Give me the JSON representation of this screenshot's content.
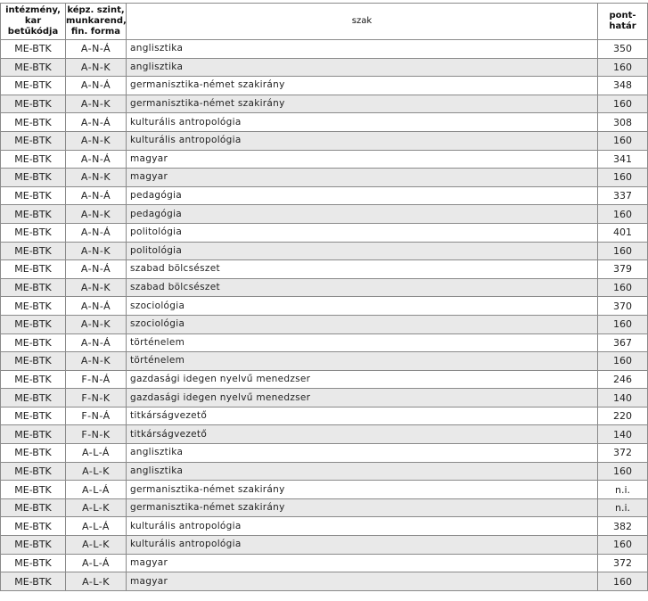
{
  "table": {
    "headers": {
      "institution": "intézmény, kar betűkódja",
      "form": "képz. szint, munkarend, fin. forma",
      "program": "szak",
      "points": "pont-határ"
    },
    "rows": [
      {
        "inst": "ME-BTK",
        "form": "A-N-Á",
        "szak": "anglisztika",
        "pont": "350"
      },
      {
        "inst": "ME-BTK",
        "form": "A-N-K",
        "szak": "anglisztika",
        "pont": "160"
      },
      {
        "inst": "ME-BTK",
        "form": "A-N-Á",
        "szak": "germanisztika-német szakirány",
        "pont": "348"
      },
      {
        "inst": "ME-BTK",
        "form": "A-N-K",
        "szak": "germanisztika-német szakirány",
        "pont": "160"
      },
      {
        "inst": "ME-BTK",
        "form": "A-N-Á",
        "szak": "kulturális antropológia",
        "pont": "308"
      },
      {
        "inst": "ME-BTK",
        "form": "A-N-K",
        "szak": "kulturális antropológia",
        "pont": "160"
      },
      {
        "inst": "ME-BTK",
        "form": "A-N-Á",
        "szak": "magyar",
        "pont": "341"
      },
      {
        "inst": "ME-BTK",
        "form": "A-N-K",
        "szak": "magyar",
        "pont": "160"
      },
      {
        "inst": "ME-BTK",
        "form": "A-N-Á",
        "szak": "pedagógia",
        "pont": "337"
      },
      {
        "inst": "ME-BTK",
        "form": "A-N-K",
        "szak": "pedagógia",
        "pont": "160"
      },
      {
        "inst": "ME-BTK",
        "form": "A-N-Á",
        "szak": "politológia",
        "pont": "401"
      },
      {
        "inst": "ME-BTK",
        "form": "A-N-K",
        "szak": "politológia",
        "pont": "160"
      },
      {
        "inst": "ME-BTK",
        "form": "A-N-Á",
        "szak": "szabad bölcsészet",
        "pont": "379"
      },
      {
        "inst": "ME-BTK",
        "form": "A-N-K",
        "szak": "szabad bölcsészet",
        "pont": "160"
      },
      {
        "inst": "ME-BTK",
        "form": "A-N-Á",
        "szak": "szociológia",
        "pont": "370"
      },
      {
        "inst": "ME-BTK",
        "form": "A-N-K",
        "szak": "szociológia",
        "pont": "160"
      },
      {
        "inst": "ME-BTK",
        "form": "A-N-Á",
        "szak": "történelem",
        "pont": "367"
      },
      {
        "inst": "ME-BTK",
        "form": "A-N-K",
        "szak": "történelem",
        "pont": "160"
      },
      {
        "inst": "ME-BTK",
        "form": "F-N-Á",
        "szak": "gazdasági idegen nyelvű menedzser",
        "pont": "246"
      },
      {
        "inst": "ME-BTK",
        "form": "F-N-K",
        "szak": "gazdasági idegen nyelvű menedzser",
        "pont": "140"
      },
      {
        "inst": "ME-BTK",
        "form": "F-N-Á",
        "szak": "titkárságvezető",
        "pont": "220"
      },
      {
        "inst": "ME-BTK",
        "form": "F-N-K",
        "szak": "titkárságvezető",
        "pont": "140"
      },
      {
        "inst": "ME-BTK",
        "form": "A-L-Á",
        "szak": "anglisztika",
        "pont": "372"
      },
      {
        "inst": "ME-BTK",
        "form": "A-L-K",
        "szak": "anglisztika",
        "pont": "160"
      },
      {
        "inst": "ME-BTK",
        "form": "A-L-Á",
        "szak": "germanisztika-német szakirány",
        "pont": "n.i."
      },
      {
        "inst": "ME-BTK",
        "form": "A-L-K",
        "szak": "germanisztika-német szakirány",
        "pont": "n.i."
      },
      {
        "inst": "ME-BTK",
        "form": "A-L-Á",
        "szak": "kulturális antropológia",
        "pont": "382"
      },
      {
        "inst": "ME-BTK",
        "form": "A-L-K",
        "szak": "kulturális antropológia",
        "pont": "160"
      },
      {
        "inst": "ME-BTK",
        "form": "A-L-Á",
        "szak": "magyar",
        "pont": "372"
      },
      {
        "inst": "ME-BTK",
        "form": "A-L-K",
        "szak": "magyar",
        "pont": "160"
      }
    ]
  }
}
